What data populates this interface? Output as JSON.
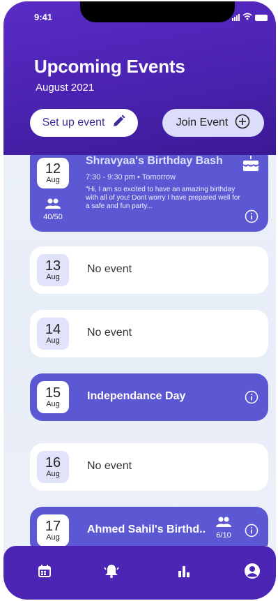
{
  "status": {
    "time": "9:41"
  },
  "header": {
    "title": "Upcoming Events",
    "subtitle": "August 2021",
    "setup_label": "Set up event",
    "join_label": "Join Event"
  },
  "events": [
    {
      "day": "12",
      "month": "Aug",
      "title": "Shravyaa's Birthday Bash",
      "time": "7:30 - 9:30 pm  •  Tomorrow",
      "message": "\"Hi, I am so  excited to have an amazing birthday with all of you! Dont worry I have prepared well for a safe and fun party...",
      "attendees": "40/50"
    },
    {
      "day": "13",
      "month": "Aug",
      "title": "No event"
    },
    {
      "day": "14",
      "month": "Aug",
      "title": "No event"
    },
    {
      "day": "15",
      "month": "Aug",
      "title": "Independance Day"
    },
    {
      "day": "16",
      "month": "Aug",
      "title": "No event"
    },
    {
      "day": "17",
      "month": "Aug",
      "title": "Ahmed Sahil's Birthd..",
      "attendees": "6/10"
    }
  ],
  "icons": {
    "setup": "pencil-icon",
    "join": "plus-circle-icon",
    "info": "info-icon",
    "cake": "cake-icon",
    "people": "people-icon",
    "tabs": [
      "calendar-icon",
      "bell-icon",
      "bar-chart-icon",
      "profile-icon"
    ]
  },
  "colors": {
    "header": "#5a2cc6",
    "event_purple": "#5c57d3",
    "tabbar": "#4c25b4",
    "join_button": "#dcdcfb"
  }
}
